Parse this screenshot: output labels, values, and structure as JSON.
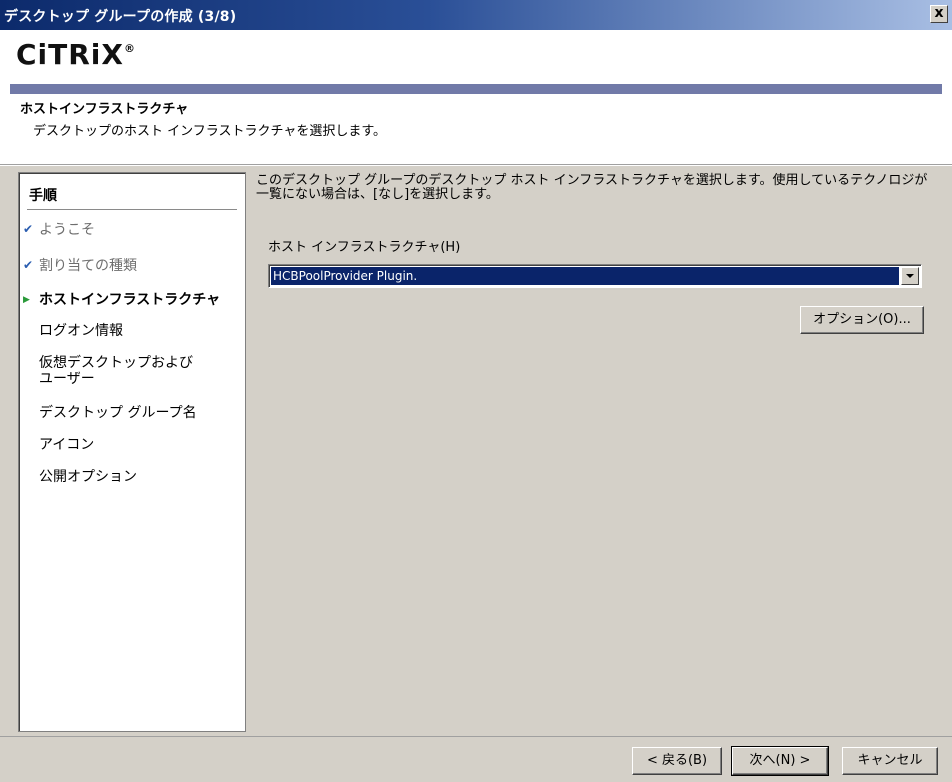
{
  "window": {
    "title": "デスクトップ グループの作成 (3/8)",
    "close_label": "x"
  },
  "logo": {
    "text": "CiTRiX",
    "reg": "®"
  },
  "header": {
    "title": "ホストインフラストラクチャ",
    "subtitle": "デスクトップのホスト インフラストラクチャを選択します。"
  },
  "steps": {
    "heading": "手順",
    "items": [
      {
        "label": "ようこそ",
        "state": "done",
        "mark": "✔"
      },
      {
        "label": "割り当ての種類",
        "state": "done",
        "mark": "✔"
      },
      {
        "label": "ホストインフラストラクチャ",
        "state": "current",
        "mark": "▶"
      },
      {
        "label": "ログオン情報",
        "state": "pending",
        "mark": ""
      },
      {
        "label": "仮想デスクトップおよび",
        "label2": "ユーザー",
        "state": "pending",
        "mark": ""
      },
      {
        "label": "デスクトップ グループ名",
        "state": "pending",
        "mark": ""
      },
      {
        "label": "アイコン",
        "state": "pending",
        "mark": ""
      },
      {
        "label": "公開オプション",
        "state": "pending",
        "mark": ""
      }
    ]
  },
  "main": {
    "description_line1": "このデスクトップ グループのデスクトップ ホスト インフラストラクチャを選択します。使用しているテクノロジが",
    "description_line2": "一覧にない場合は、[なし]を選択します。",
    "host_label": "ホスト インフラストラクチャ(H)",
    "host_value": "HCBPoolProvider Plugin.",
    "options_button": "オプション(O)..."
  },
  "footer": {
    "back_button": "< 戻る(B)",
    "next_button": "次へ(N) >",
    "cancel_button": "キャンセル"
  },
  "colors": {
    "titlebar_start": "#0c2a6b",
    "accent_bar": "#717aa8",
    "selection": "#0a246a",
    "dialog_bg": "#d4d0c8"
  }
}
